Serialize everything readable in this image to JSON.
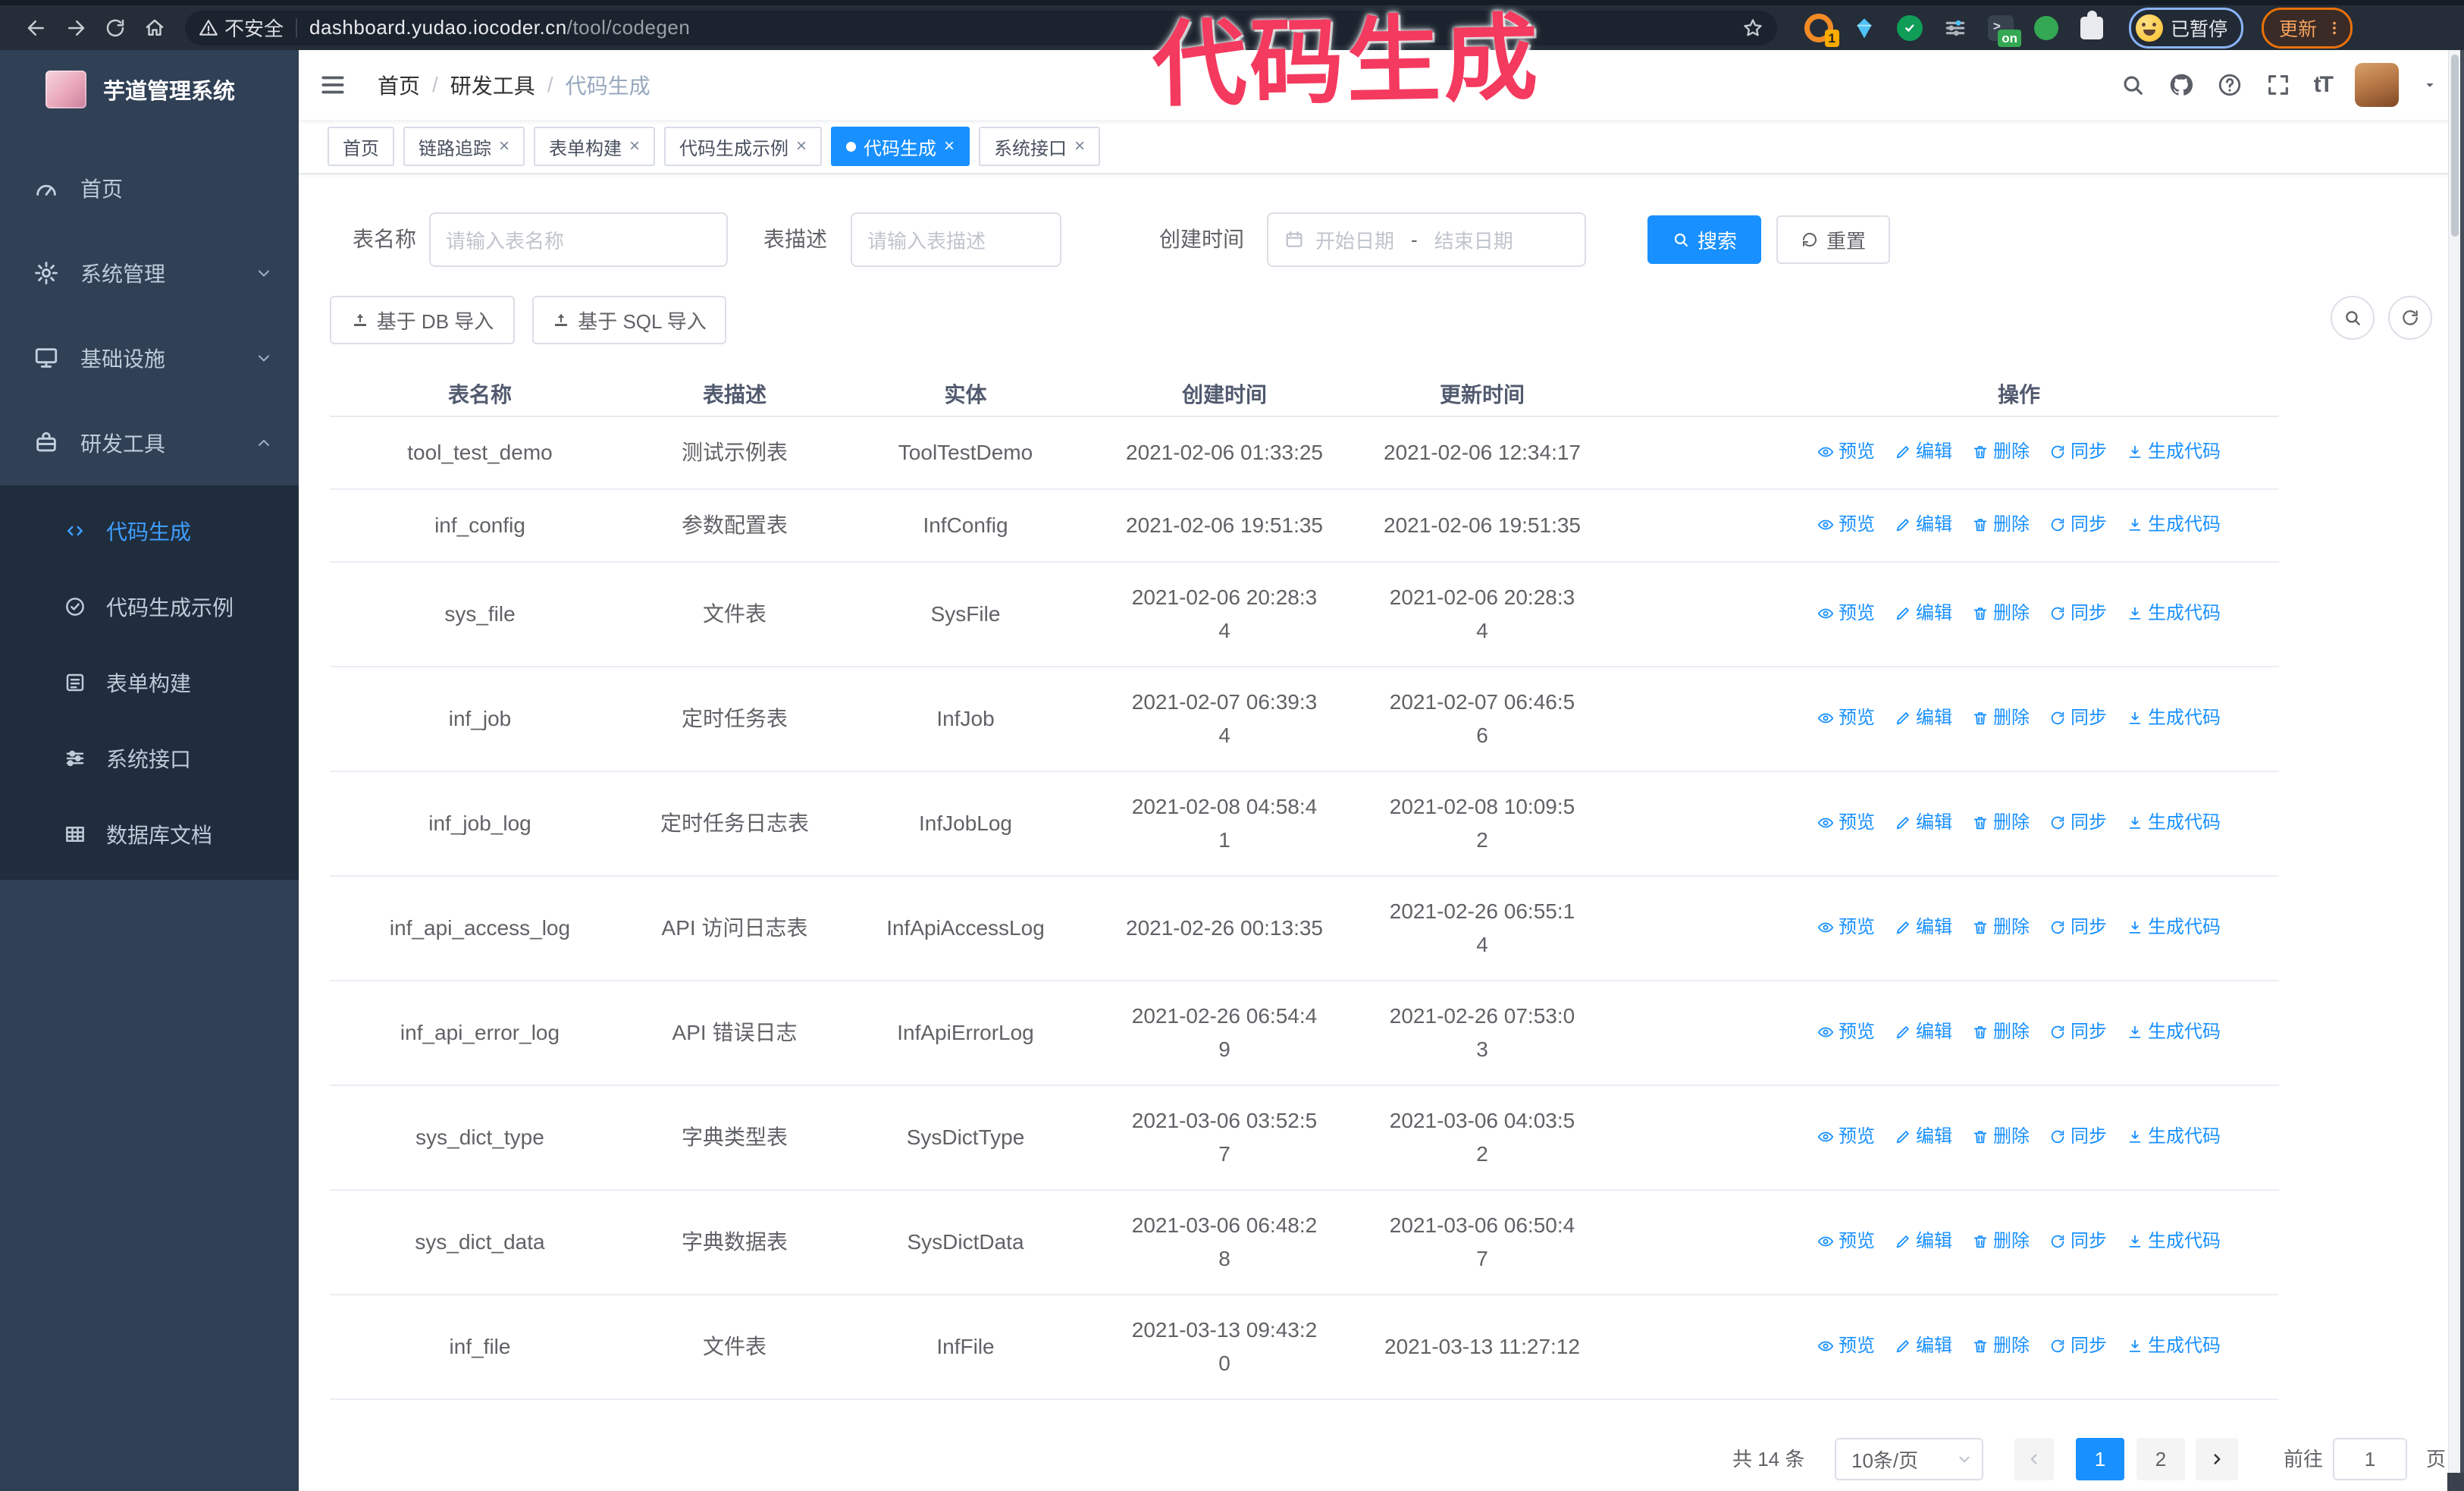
{
  "browser": {
    "security_warning": "不安全",
    "url_host": "dashboard.yudao.iocoder.cn",
    "url_path": "/tool/codegen",
    "profile_status": "已暂停",
    "update_label": "更新",
    "extensions": [
      {
        "icon": "extension-ring-icon",
        "badge": "1"
      },
      {
        "icon": "extension-gem-icon",
        "badge": ""
      },
      {
        "icon": "extension-shield-icon",
        "badge": ""
      },
      {
        "icon": "extension-toggles-icon",
        "badge": ""
      },
      {
        "icon": "extension-terminal-icon",
        "badge": "on"
      },
      {
        "icon": "extension-green-icon",
        "badge": ""
      },
      {
        "icon": "extension-puzzle-icon",
        "badge": ""
      }
    ]
  },
  "annotation": {
    "text": "代码生成",
    "color": "#f43a5e"
  },
  "sidebar": {
    "logo_title": "芋道管理系统",
    "items": [
      {
        "label": "首页",
        "icon": "dashboard-icon",
        "arrow": "none",
        "active": false
      },
      {
        "label": "系统管理",
        "icon": "gear-icon",
        "arrow": "down",
        "active": false
      },
      {
        "label": "基础设施",
        "icon": "monitor-icon",
        "arrow": "down",
        "active": false
      },
      {
        "label": "研发工具",
        "icon": "suitcase-icon",
        "arrow": "up",
        "active": true
      }
    ],
    "submenu": [
      {
        "label": "代码生成",
        "icon": "code-icon",
        "active": true
      },
      {
        "label": "代码生成示例",
        "icon": "example-icon",
        "active": false
      },
      {
        "label": "表单构建",
        "icon": "form-icon",
        "active": false
      },
      {
        "label": "系统接口",
        "icon": "sliders-icon",
        "active": false
      },
      {
        "label": "数据库文档",
        "icon": "database-icon",
        "active": false
      }
    ]
  },
  "navbar": {
    "breadcrumb": [
      "首页",
      "研发工具",
      "代码生成"
    ],
    "separator": "/",
    "font_icon_text": "tT"
  },
  "tags": [
    {
      "label": "首页",
      "closable": false,
      "active": false
    },
    {
      "label": "链路追踪",
      "closable": true,
      "active": false
    },
    {
      "label": "表单构建",
      "closable": true,
      "active": false
    },
    {
      "label": "代码生成示例",
      "closable": true,
      "active": false
    },
    {
      "label": "代码生成",
      "closable": true,
      "active": true
    },
    {
      "label": "系统接口",
      "closable": true,
      "active": false
    }
  ],
  "search_form": {
    "table_name_label": "表名称",
    "table_name_placeholder": "请输入表名称",
    "table_desc_label": "表描述",
    "table_desc_placeholder": "请输入表描述",
    "create_time_label": "创建时间",
    "start_date_placeholder": "开始日期",
    "range_separator": "-",
    "end_date_placeholder": "结束日期",
    "search_label": "搜索",
    "reset_label": "重置"
  },
  "toolbar": {
    "import_db_label": "基于 DB 导入",
    "import_sql_label": "基于 SQL 导入"
  },
  "table": {
    "columns": [
      "表名称",
      "表描述",
      "实体",
      "创建时间",
      "更新时间",
      "操作"
    ],
    "ops": [
      {
        "label": "预览",
        "icon": "eye-icon"
      },
      {
        "label": "编辑",
        "icon": "edit-icon"
      },
      {
        "label": "删除",
        "icon": "trash-icon"
      },
      {
        "label": "同步",
        "icon": "sync-icon"
      },
      {
        "label": "生成代码",
        "icon": "download-icon"
      }
    ],
    "rows": [
      {
        "name": "tool_test_demo",
        "desc": "测试示例表",
        "entity": "ToolTestDemo",
        "create_time": "2021-02-06 01:33:25",
        "update_time": "2021-02-06 12:34:17"
      },
      {
        "name": "inf_config",
        "desc": "参数配置表",
        "entity": "InfConfig",
        "create_time": "2021-02-06 19:51:35",
        "update_time": "2021-02-06 19:51:35"
      },
      {
        "name": "sys_file",
        "desc": "文件表",
        "entity": "SysFile",
        "create_time": "2021-02-06 20:28:3\n4",
        "update_time": "2021-02-06 20:28:3\n4"
      },
      {
        "name": "inf_job",
        "desc": "定时任务表",
        "entity": "InfJob",
        "create_time": "2021-02-07 06:39:3\n4",
        "update_time": "2021-02-07 06:46:5\n6"
      },
      {
        "name": "inf_job_log",
        "desc": "定时任务日志表",
        "entity": "InfJobLog",
        "create_time": "2021-02-08 04:58:4\n1",
        "update_time": "2021-02-08 10:09:5\n2"
      },
      {
        "name": "inf_api_access_log",
        "desc": "API 访问日志表",
        "entity": "InfApiAccessLog",
        "create_time": "2021-02-26 00:13:35",
        "update_time": "2021-02-26 06:55:1\n4"
      },
      {
        "name": "inf_api_error_log",
        "desc": "API 错误日志",
        "entity": "InfApiErrorLog",
        "create_time": "2021-02-26 06:54:4\n9",
        "update_time": "2021-02-26 07:53:0\n3"
      },
      {
        "name": "sys_dict_type",
        "desc": "字典类型表",
        "entity": "SysDictType",
        "create_time": "2021-03-06 03:52:5\n7",
        "update_time": "2021-03-06 04:03:5\n2"
      },
      {
        "name": "sys_dict_data",
        "desc": "字典数据表",
        "entity": "SysDictData",
        "create_time": "2021-03-06 06:48:2\n8",
        "update_time": "2021-03-06 06:50:4\n7"
      },
      {
        "name": "inf_file",
        "desc": "文件表",
        "entity": "InfFile",
        "create_time": "2021-03-13 09:43:2\n0",
        "update_time": "2021-03-13 11:27:12"
      }
    ]
  },
  "pagination": {
    "total_text": "共 14 条",
    "page_size": "10条/页",
    "pages": [
      "1",
      "2"
    ],
    "active_page": "1",
    "goto_label": "前往",
    "goto_value": "1",
    "goto_suffix": "页"
  }
}
